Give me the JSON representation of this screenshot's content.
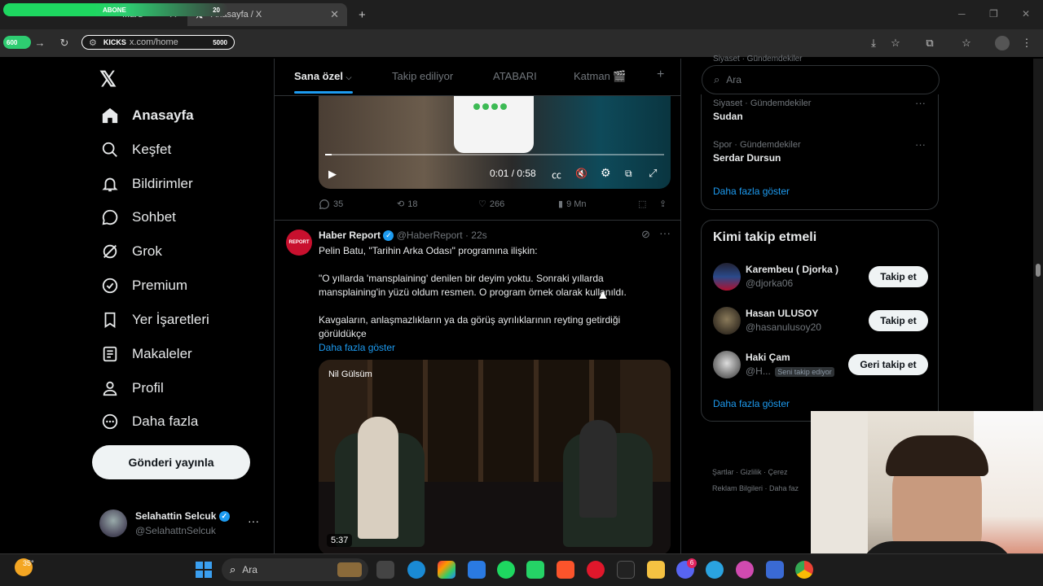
{
  "browser": {
    "tabs": [
      {
        "label": "...ard",
        "active": false
      },
      {
        "label": "Anasayfa / X",
        "active": true
      }
    ],
    "new_tab": "+",
    "address": "x.com/home",
    "overlay_left": "ABONE",
    "overlay_count": "20",
    "kicks_left": "600",
    "kicks_label": "KICKS",
    "kicks_right": "5000"
  },
  "nav": {
    "items": [
      {
        "label": "Anasayfa",
        "icon": "home-icon"
      },
      {
        "label": "Keşfet",
        "icon": "search-icon"
      },
      {
        "label": "Bildirimler",
        "icon": "bell-icon"
      },
      {
        "label": "Sohbet",
        "icon": "chat-icon"
      },
      {
        "label": "Grok",
        "icon": "grok-icon"
      },
      {
        "label": "Premium",
        "icon": "verified-icon"
      },
      {
        "label": "Yer İşaretleri",
        "icon": "bookmark-icon"
      },
      {
        "label": "Makaleler",
        "icon": "article-icon"
      },
      {
        "label": "Profil",
        "icon": "person-icon"
      },
      {
        "label": "Daha fazla",
        "icon": "more-circle-icon"
      }
    ],
    "post_button": "Gönderi yayınla",
    "account": {
      "name": "Selahattin Selcuk",
      "handle": "@SelahattnSelcuk"
    }
  },
  "timeline": {
    "tabs": [
      "Sana özel",
      "Takip ediliyor",
      "ATABARI",
      "Katman 🎬"
    ],
    "add_tab": "+",
    "video1": {
      "time": "0:01 / 0:58",
      "progress": 0.02
    },
    "actions1": {
      "replies": "35",
      "reposts": "18",
      "likes": "266",
      "views": "9 Mn"
    },
    "post": {
      "author": "Haber Report",
      "avatar_text": "REPORT",
      "handle": "@HaberReport",
      "time": "· 22s",
      "line1": "Pelin Batu, \"Tarihin Arka Odası\" programına ilişkin:",
      "line2": "\"O yıllarda 'mansplaining' denilen bir deyim yoktu. Sonraki yıllarda",
      "line3": "mansplaining'in yüzü oldum resmen. O program örnek olarak kullanıldı.",
      "line4": "Kavgaların, anlaşmazlıkların ya da görüş ayrılıklarının reyting getirdiği",
      "line5": "görüldükçe",
      "show_more": "Daha fazla göster",
      "video_watermark": "Nil Gülsüm",
      "video_duration": "5:37"
    }
  },
  "right": {
    "search_placeholder": "Ara",
    "top_cut": "Siyaset · Gündemdekiler",
    "trends": [
      {
        "category": "Siyaset · Gündemdekiler",
        "name": "Sudan"
      },
      {
        "category": "Spor · Gündemdekiler",
        "name": "Serdar Dursun"
      }
    ],
    "trends_more": "Daha fazla göster",
    "who_title": "Kimi takip etmeli",
    "who": [
      {
        "name": "Karembeu ( Djorka )",
        "handle": "@djorka06",
        "button": "Takip et"
      },
      {
        "name": "Hasan ULUSOY",
        "handle": "@hasanulusoy20",
        "button": "Takip et"
      },
      {
        "name": "Haki Çam",
        "handle": "@H...",
        "badge": "Seni takip ediyor",
        "button": "Geri takip et"
      }
    ],
    "who_more": "Daha fazla göster",
    "footer": [
      "Şartlar",
      "Gizlilik",
      "Çerez",
      "Reklam Bilgileri",
      "Daha faz"
    ]
  },
  "taskbar": {
    "weather": "35°",
    "search": "Ara",
    "notif_count": "6"
  },
  "colors": {
    "accent": "#1d9bf0",
    "bg": "#000000",
    "border": "#2f3336"
  }
}
